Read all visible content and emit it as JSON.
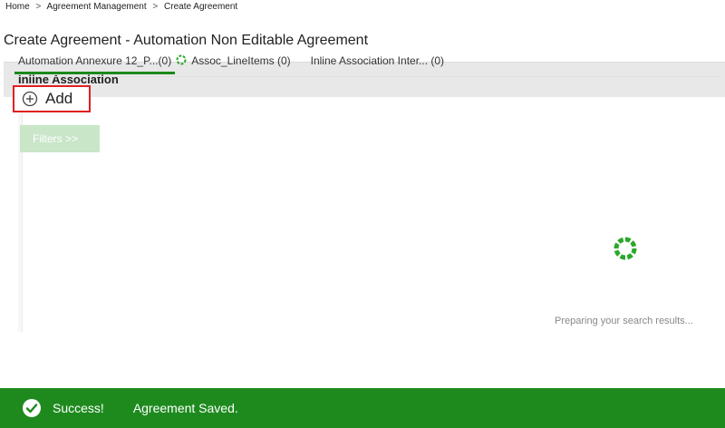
{
  "breadcrumb": {
    "items": [
      "Home",
      "Agreement Management",
      "Create Agreement"
    ],
    "separator": ">"
  },
  "page": {
    "title": "Create Agreement - Automation Non Editable Agreement"
  },
  "panel": {
    "title": "Inline Association",
    "tabs": [
      {
        "label": "Automation Annexure 12_P...(0)",
        "active": true
      },
      {
        "label": "Assoc_LineItems (0)",
        "active": false
      },
      {
        "label": "Inline Association Inter... (0)",
        "active": false
      }
    ],
    "add_label": "Add",
    "filters_label": "Filters >>",
    "search_status": "Preparing your search results..."
  },
  "toast": {
    "title": "Success!",
    "message": "Agreement Saved.",
    "color": "#1e8a1e"
  },
  "colors": {
    "accent": "#1a8a1a",
    "highlight_border": "#e02020",
    "filters_bg": "#c9e6c9"
  },
  "icons": {
    "add": "plus-circle-icon",
    "tab_loading": "spinner-icon",
    "content_loading": "spinner-icon",
    "toast": "check-circle-icon"
  }
}
